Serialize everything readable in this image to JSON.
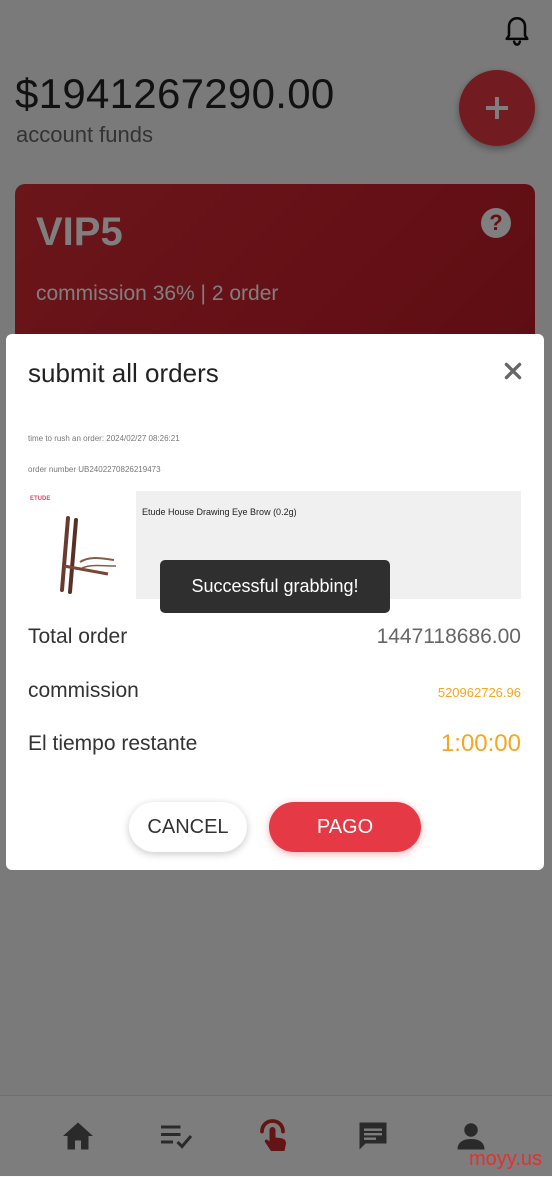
{
  "header": {
    "balance": "$1941267290.00",
    "balance_label": "account funds",
    "notification_icon": "bell-icon",
    "add_icon": "plus-icon"
  },
  "vip": {
    "level": "VIP5",
    "commission_text": "commission 36% | 2 order",
    "help_icon": "question-icon",
    "help_glyph": "?"
  },
  "modal": {
    "title": "submit all orders",
    "close_icon": "close-icon",
    "rush_time": "time to rush an order:  2024/02/27 08:26:21",
    "order_number": "order number UB2402270826219473",
    "product_name": "Etude House Drawing Eye Brow (0.2g)",
    "brand_logo_text": "ETUDE",
    "total_label": "Total order",
    "total_value": "1447118686.00",
    "commission_label": "commission",
    "commission_value": "520962726.96",
    "time_label": "El tiempo restante",
    "time_value": "1:00:00",
    "cancel_label": "CANCEL",
    "pay_label": "PAGO"
  },
  "toast": {
    "message": "Successful grabbing!"
  },
  "nav": {
    "items": [
      "home-icon",
      "task-list-icon",
      "grab-order-icon",
      "message-icon",
      "profile-icon"
    ]
  },
  "watermark": "moyy.us",
  "colors": {
    "accent": "#e53945",
    "highlight": "#f5a623",
    "overlay": "rgba(0,0,0,0.5)"
  }
}
